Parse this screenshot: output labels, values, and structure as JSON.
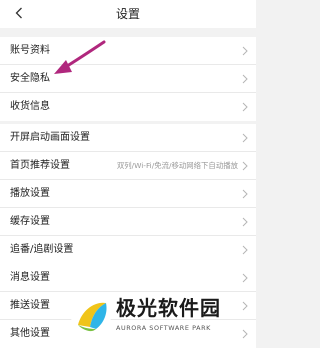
{
  "header": {
    "title": "设置"
  },
  "groups": [
    {
      "items": [
        {
          "label": "账号资料"
        },
        {
          "label": "安全隐私"
        },
        {
          "label": "收货信息"
        }
      ]
    },
    {
      "items": [
        {
          "label": "开屏启动画面设置"
        },
        {
          "label": "首页推荐设置",
          "value": "双列/Wi-Fi/免流/移动网络下自动播放"
        },
        {
          "label": "播放设置"
        },
        {
          "label": "缓存设置"
        },
        {
          "label": "追番/追剧设置"
        }
      ]
    },
    {
      "items": [
        {
          "label": "消息设置"
        },
        {
          "label": "推送设置"
        },
        {
          "label": "其他设置"
        }
      ]
    }
  ],
  "watermark": {
    "brand": "极光软件园",
    "tagline": "AURORA SOFTWARE PARK"
  },
  "colors": {
    "background": "#f2f2f2",
    "row": "#ffffff",
    "annotation_arrow": "#b0277d"
  }
}
